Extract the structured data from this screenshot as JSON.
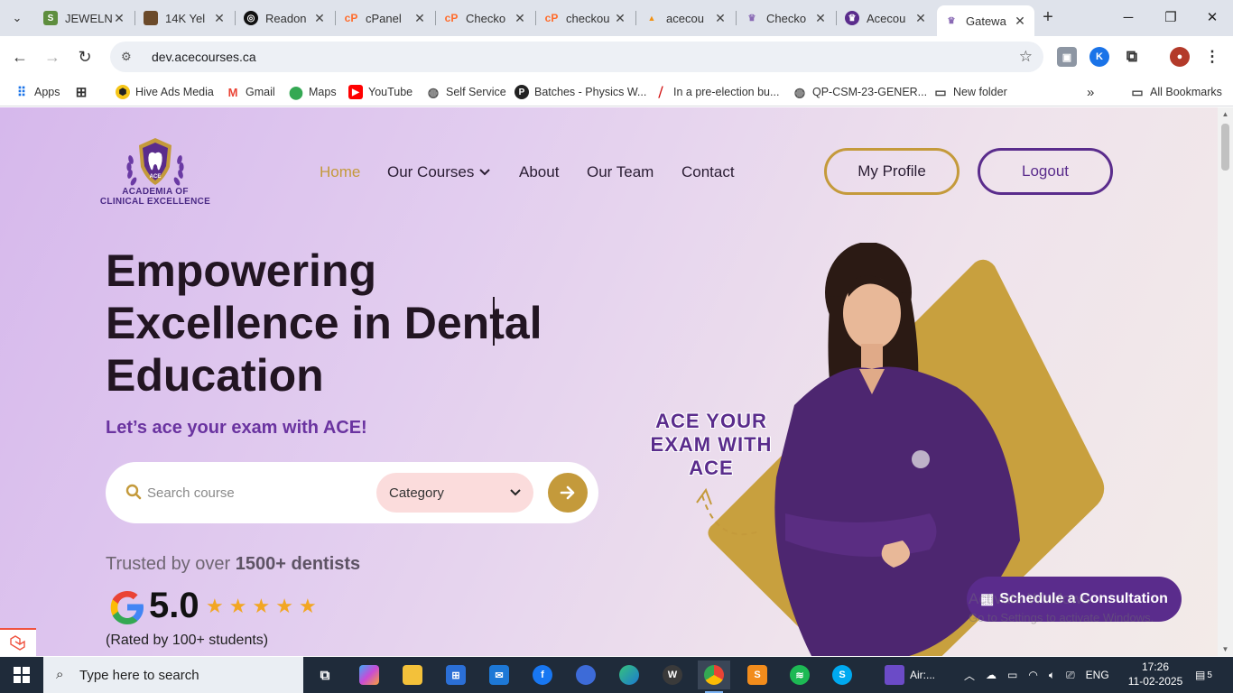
{
  "browser": {
    "tabs": [
      {
        "title": "JEWELN",
        "icon": "shopify-icon",
        "color": "#5e8e3e"
      },
      {
        "title": "14K Yel",
        "icon": "product-thumbnail-icon",
        "color": "#6b4a2a"
      },
      {
        "title": "Readon",
        "icon": "openai-icon",
        "color": "#111111"
      },
      {
        "title": "cPanel",
        "icon": "cpanel-icon",
        "color": "#ff6c2c"
      },
      {
        "title": "Checko",
        "icon": "cpanel-icon",
        "color": "#ff6c2c"
      },
      {
        "title": "checkou",
        "icon": "cpanel-icon",
        "color": "#ff6c2c"
      },
      {
        "title": "acecou",
        "icon": "phpmyadmin-icon",
        "color": "#f29111"
      },
      {
        "title": "Checko",
        "icon": "ace-site-icon",
        "color": "#8a6ab5"
      },
      {
        "title": "Acecou",
        "icon": "ace-site-icon",
        "color": "#5a2c8c"
      },
      {
        "title": "Gatewa",
        "icon": "ace-site-icon",
        "color": "#8a6ab5"
      }
    ],
    "url": "dev.acecourses.ca",
    "bookmarks": [
      {
        "label": "Apps",
        "icon": "apps-grid-icon"
      },
      {
        "label": "",
        "icon": "tab-groups-icon"
      },
      {
        "label": "Hive Ads Media",
        "icon": "hive-icon"
      },
      {
        "label": "Gmail",
        "icon": "gmail-icon"
      },
      {
        "label": "Maps",
        "icon": "maps-icon"
      },
      {
        "label": "YouTube",
        "icon": "youtube-icon"
      },
      {
        "label": "Self Service",
        "icon": "globe-icon"
      },
      {
        "label": "Batches - Physics W...",
        "icon": "pw-icon"
      },
      {
        "label": "In a pre-election bu...",
        "icon": "news-icon"
      },
      {
        "label": "QP-CSM-23-GENER...",
        "icon": "globe-icon"
      },
      {
        "label": "New folder",
        "icon": "folder-icon"
      }
    ],
    "all_bookmarks": "All Bookmarks"
  },
  "site": {
    "logo_text": [
      "ACADEMIA OF",
      "CLINICAL EXCELLENCE"
    ],
    "logo_badge": "ACE",
    "nav": {
      "home": "Home",
      "courses": "Our Courses",
      "about": "About",
      "team": "Our Team",
      "contact": "Contact"
    },
    "my_profile": "My Profile",
    "logout": "Logout",
    "hero": {
      "title_line1": "Empowering",
      "title_line2": "Excellence in Dental",
      "title_line3": "Education",
      "subtitle": "Let’s ace your exam with ACE!",
      "tagline": [
        "ACE YOUR",
        "EXAM WITH",
        "ACE"
      ]
    },
    "search": {
      "placeholder": "Search course",
      "category": "Category"
    },
    "trust": {
      "prefix": "Trusted by over ",
      "count": "1500+ dentists",
      "rating": "5.0",
      "stars": 5,
      "rated_by": "(Rated by 100+ students)"
    },
    "consult_button": "Schedule a Consultation",
    "watermark": {
      "line1": "Activate Windows",
      "line2": "Go to Settings to activate Windows."
    },
    "colors": {
      "accent_gold": "#c49a3b",
      "brand_purple": "#5a2c8c"
    }
  },
  "taskbar": {
    "search_placeholder": "Type here to search",
    "air_label": "Air:...",
    "language": "ENG",
    "time": "17:26",
    "date": "11-02-2025",
    "notification_count": "5"
  }
}
